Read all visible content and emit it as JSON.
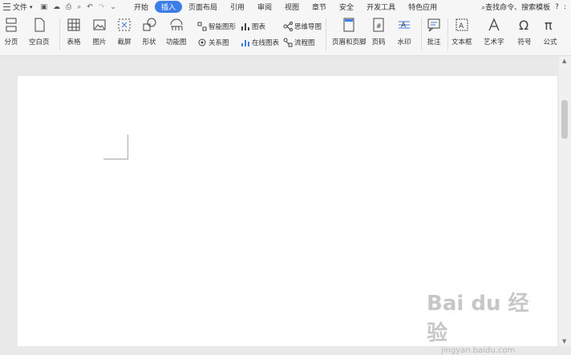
{
  "menubar": {
    "file": "文件",
    "tabs": [
      "开始",
      "插入",
      "页面布局",
      "引用",
      "审阅",
      "视图",
      "章节",
      "安全",
      "开发工具",
      "特色应用"
    ],
    "search": "查找命令、搜索模板",
    "help": "?",
    "more": ":"
  },
  "ribbon": {
    "page_break": "分页",
    "blank_page": "空白页",
    "table": "表格",
    "picture": "图片",
    "screenshot": "截屏",
    "shape": "形状",
    "function": "功能图",
    "smart_graphic": "智能图形",
    "chart": "图表",
    "mind_map": "思维导图",
    "relation": "关系图",
    "online_chart": "在线图表",
    "flowchart": "流程图",
    "header_footer": "页眉和页脚",
    "page_number": "页码",
    "watermark": "水印",
    "comment": "批注",
    "textbox": "文本框",
    "wordart": "艺术字",
    "symbol": "符号",
    "formula": "公式"
  },
  "watermark_text": {
    "brand": "Bai du 经验",
    "url": "jingyan.baidu.com"
  }
}
